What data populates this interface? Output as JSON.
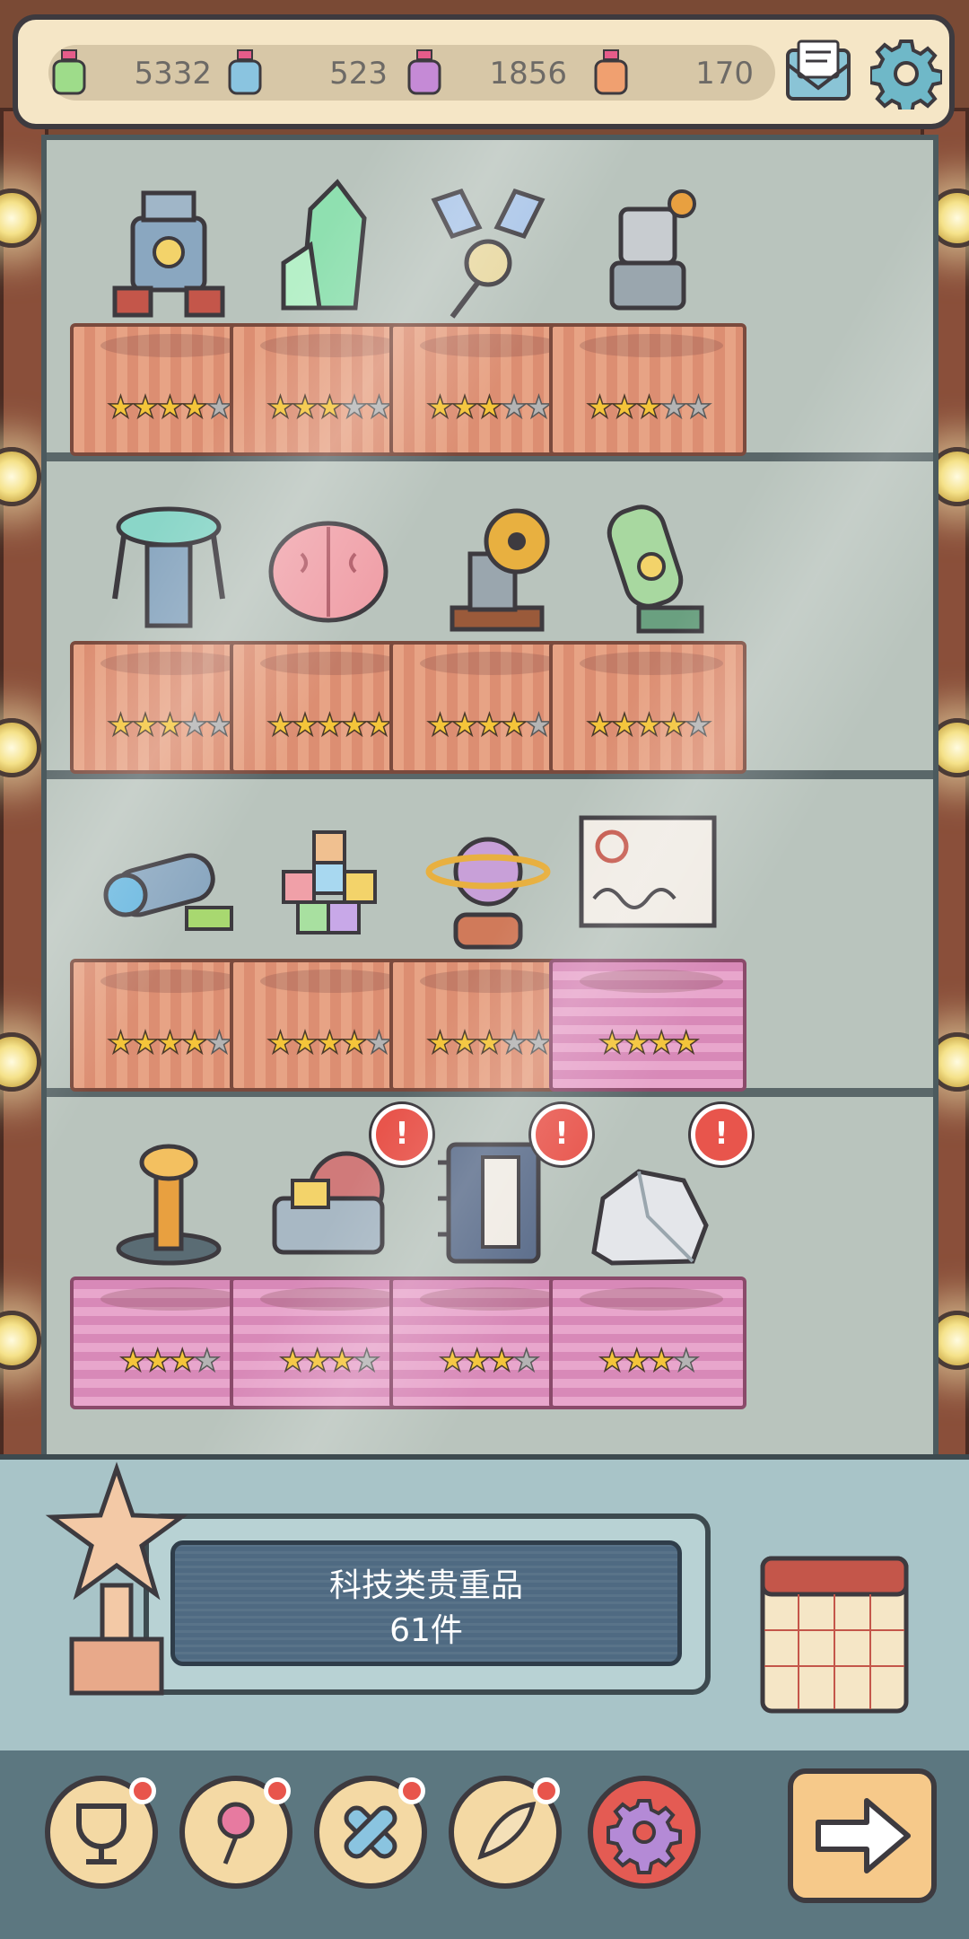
{
  "resources": [
    {
      "icon": "green-potion-icon",
      "value": "5332"
    },
    {
      "icon": "blue-potion-icon",
      "value": "523"
    },
    {
      "icon": "purple-potion-icon",
      "value": "1856"
    },
    {
      "icon": "orange-potion-icon",
      "value": "170"
    }
  ],
  "header": {
    "mail_icon": "mail-icon",
    "settings_icon": "gear-icon"
  },
  "shelves": [
    [
      {
        "name": "robot",
        "cloth": "orange",
        "stars": 5,
        "filled": 4,
        "alert": false
      },
      {
        "name": "crystal",
        "cloth": "orange",
        "stars": 5,
        "filled": 3,
        "alert": false
      },
      {
        "name": "satellite",
        "cloth": "orange",
        "stars": 5,
        "filled": 3,
        "alert": false
      },
      {
        "name": "mech-robot",
        "cloth": "orange",
        "stars": 5,
        "filled": 3,
        "alert": false
      }
    ],
    [
      {
        "name": "teleporter",
        "cloth": "orange",
        "stars": 5,
        "filled": 3,
        "alert": false
      },
      {
        "name": "brain",
        "cloth": "orange",
        "stars": 5,
        "filled": 5,
        "alert": false
      },
      {
        "name": "nuclear-device",
        "cloth": "orange",
        "stars": 5,
        "filled": 4,
        "alert": false
      },
      {
        "name": "radioactive-canister",
        "cloth": "orange",
        "stars": 5,
        "filled": 4,
        "alert": false
      }
    ],
    [
      {
        "name": "space-telescope",
        "cloth": "orange",
        "stars": 5,
        "filled": 4,
        "alert": false
      },
      {
        "name": "cube-pile",
        "cloth": "orange",
        "stars": 5,
        "filled": 4,
        "alert": false
      },
      {
        "name": "planet-globe",
        "cloth": "orange",
        "stars": 5,
        "filled": 3,
        "alert": false
      },
      {
        "name": "dna-document",
        "cloth": "pink",
        "stars": 4,
        "filled": 4,
        "alert": false
      }
    ],
    [
      {
        "name": "tesla-coil",
        "cloth": "pink",
        "stars": 4,
        "filled": 3,
        "alert": false
      },
      {
        "name": "engine-machine",
        "cloth": "pink",
        "stars": 4,
        "filled": 3,
        "alert": true
      },
      {
        "name": "ancient-book",
        "cloth": "pink",
        "stars": 4,
        "filled": 3,
        "alert": true
      },
      {
        "name": "ore-rock",
        "cloth": "pink",
        "stars": 4,
        "filled": 3,
        "alert": true
      }
    ]
  ],
  "screen": {
    "category": "科技类贵重品",
    "count": "61件"
  },
  "alert_glyph": "!",
  "star_glyph": "★",
  "nav": [
    {
      "icon": "trophy-icon",
      "dot": true
    },
    {
      "icon": "rose-icon",
      "dot": true
    },
    {
      "icon": "bandage-icon",
      "dot": true
    },
    {
      "icon": "feather-icon",
      "dot": true
    },
    {
      "icon": "gear-icon",
      "dot": false
    }
  ],
  "colors": {
    "accent": "#f4c53a",
    "alert": "#e8554c",
    "screen": "#4f6a82"
  }
}
